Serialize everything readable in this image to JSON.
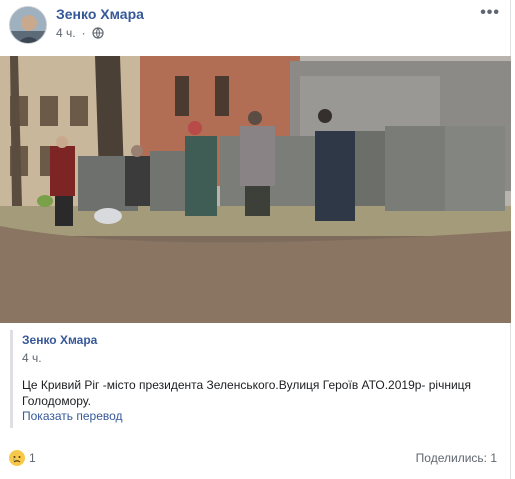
{
  "post": {
    "author": "Зенко Хмара",
    "time": "4 ч.",
    "more_label": "•••",
    "privacy_icon": "globe-icon"
  },
  "shared": {
    "author": "Зенко Хмара",
    "time": "4 ч.",
    "text": "Це Кривий Ріг -місто президента Зеленського.Вулиця Героїв АТО.2019р- річниця Голодомору.",
    "translate_label": "Показать перевод"
  },
  "footer": {
    "reaction_icon": "sad-reaction-icon",
    "reaction_count": "1",
    "shares_label": "Поделились: 1"
  }
}
